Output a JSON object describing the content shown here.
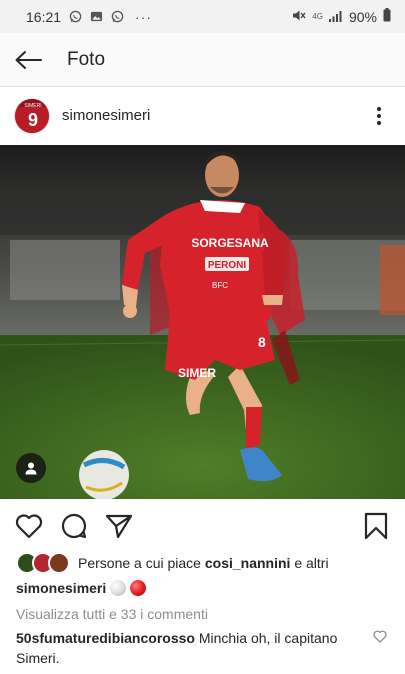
{
  "status_bar": {
    "time": "16:21",
    "more_dots": "···",
    "signal_label": "4G",
    "battery": "90%"
  },
  "header": {
    "title": "Foto"
  },
  "post": {
    "username": "simonesimeri",
    "avatar_jersey_number": "9",
    "avatar_jersey_name": "SIMERI",
    "photo_texts": {
      "sponsor_main": "SORGESANA",
      "sponsor_second": "PERONI",
      "sponsor_third": "BFC",
      "shorts_text": "SIMER",
      "player_number": "8"
    }
  },
  "likes": {
    "prefix": "Persone a cui piace ",
    "user": "cosi_nannini",
    "suffix": " e altri"
  },
  "caption": {
    "username": "simonesimeri"
  },
  "comments": {
    "view_all": "Visualizza tutti e 33 i commenti",
    "first": {
      "username": "50sfumaturedibiancorosso",
      "text": " Minchia oh, il capitano Simeri."
    }
  },
  "colors": {
    "accent_red": "#d6232b",
    "grass": "#3d6b1f",
    "background": "#ffffff",
    "muted_text": "#8e8e8e"
  },
  "icons": {
    "back": "arrow-left-icon",
    "more": "vertical-dots-icon",
    "like": "heart-outline-icon",
    "comment": "comment-bubble-icon",
    "share": "paper-plane-icon",
    "save": "bookmark-icon",
    "tag": "user-tag-icon"
  }
}
